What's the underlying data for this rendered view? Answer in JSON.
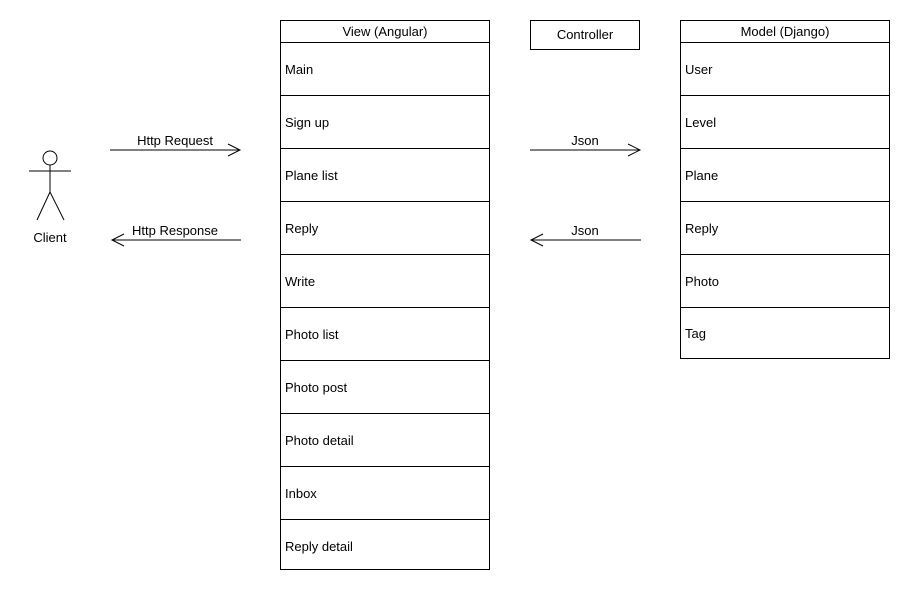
{
  "actor": {
    "label": "Client"
  },
  "view": {
    "title": "View (Angular)",
    "items": [
      "Main",
      "Sign up",
      "Plane list",
      "Reply",
      "Write",
      "Photo list",
      "Photo post",
      "Photo detail",
      "Inbox",
      "Reply detail"
    ]
  },
  "controller": {
    "title": "Controller"
  },
  "model": {
    "title": "Model (Django)",
    "items": [
      "User",
      "Level",
      "Plane",
      "Reply",
      "Photo",
      "Tag"
    ]
  },
  "arrows": {
    "http_request": "Http Request",
    "http_response": "Http Response",
    "json_to_model": "Json",
    "json_to_controller": "Json"
  }
}
